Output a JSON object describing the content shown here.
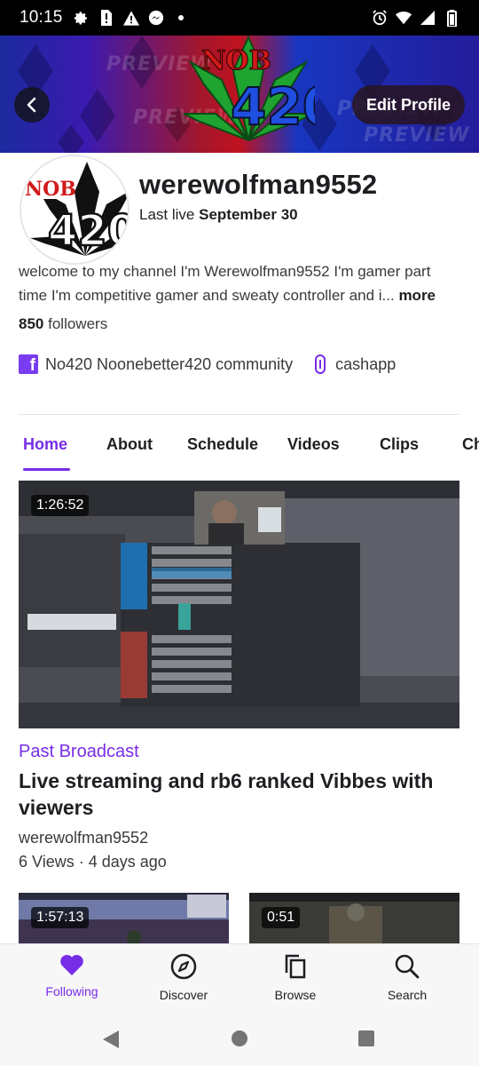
{
  "status_bar": {
    "time": "10:15",
    "left_icons": [
      "settings-icon",
      "sim-alert-icon",
      "warning-icon",
      "messenger-icon",
      "dot-icon"
    ],
    "right_icons": [
      "alarm-icon",
      "wifi-icon",
      "signal-icon",
      "battery-icon"
    ]
  },
  "header": {
    "edit_profile_label": "Edit Profile",
    "banner_logo_text": "NOB 420",
    "banner_watermark": "PREVIEW"
  },
  "profile": {
    "username": "werewolfman9552",
    "last_live_prefix": "Last live",
    "last_live_date": "September 30",
    "avatar_text": "NOB 420",
    "bio": "welcome to my channel I'm Werewolfman9552 I'm gamer  part time I'm competitive gamer and sweaty controller and i...",
    "more_label": "more",
    "followers_count": "850",
    "followers_label": "followers",
    "social_links": [
      {
        "icon": "facebook-icon",
        "label": "No420 Noonebetter420 community"
      },
      {
        "icon": "link-icon",
        "label": "cashapp"
      }
    ]
  },
  "tabs": [
    {
      "label": "Home",
      "active": true
    },
    {
      "label": "About"
    },
    {
      "label": "Schedule"
    },
    {
      "label": "Videos"
    },
    {
      "label": "Clips"
    },
    {
      "label": "Ch"
    }
  ],
  "featured_video": {
    "duration": "1:26:52",
    "type_label": "Past Broadcast",
    "title": "Live streaming and rb6  ranked Vibbes with viewers",
    "channel": "werewolfman9552",
    "meta": "6 Views · 4 days ago"
  },
  "more_videos": [
    {
      "duration": "1:57:13"
    },
    {
      "duration": "0:51"
    }
  ],
  "bottom_nav": [
    {
      "label": "Following",
      "icon": "heart-icon",
      "active": true
    },
    {
      "label": "Discover",
      "icon": "compass-icon"
    },
    {
      "label": "Browse",
      "icon": "browse-icon"
    },
    {
      "label": "Search",
      "icon": "search-icon"
    }
  ],
  "colors": {
    "accent": "#772ce8",
    "text": "#1f1f23"
  }
}
